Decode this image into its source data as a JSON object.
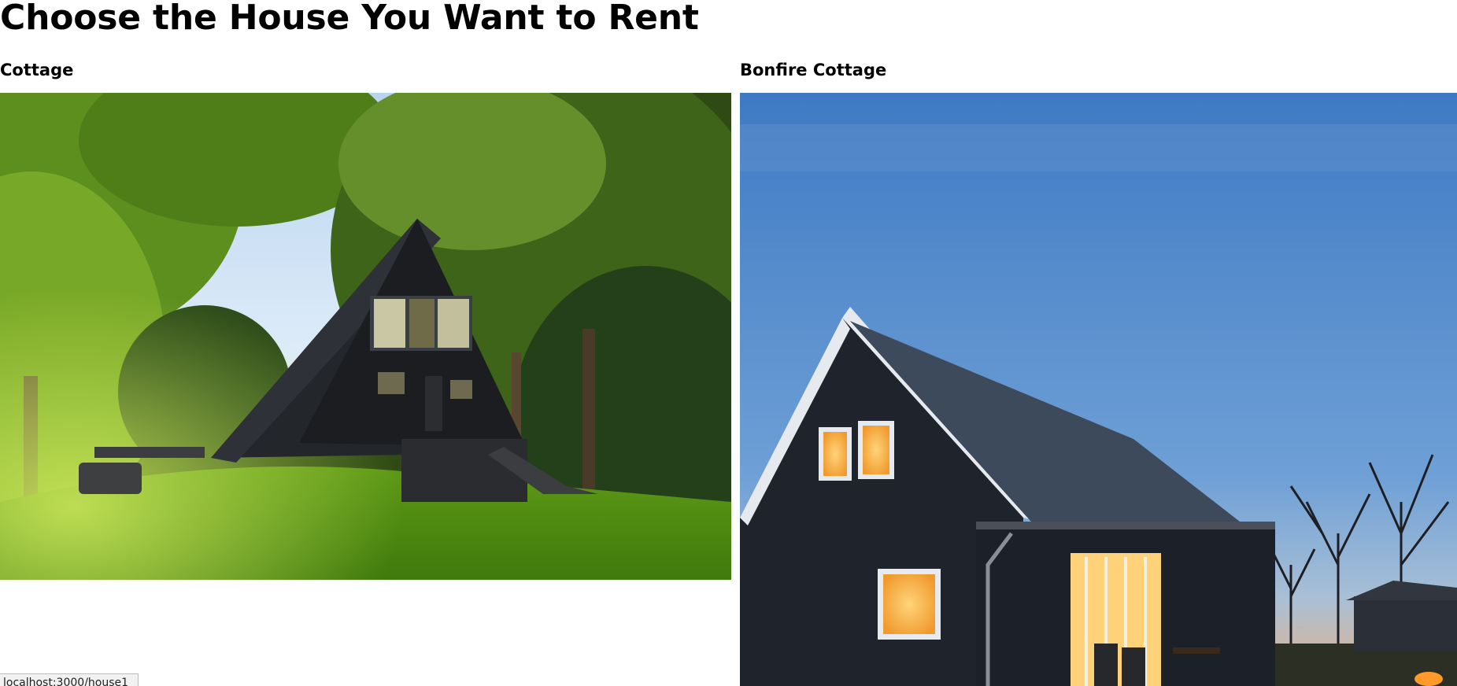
{
  "page": {
    "title": "Choose the House You Want to Rent"
  },
  "houses": [
    {
      "name": "Cottage",
      "image_icon": "a-frame-cottage-photo"
    },
    {
      "name": "Bonfire Cottage",
      "image_icon": "bonfire-cottage-photo"
    }
  ],
  "status_bar": {
    "url": "localhost:3000/house1"
  },
  "colors": {
    "text": "#000000",
    "background": "#ffffff"
  }
}
